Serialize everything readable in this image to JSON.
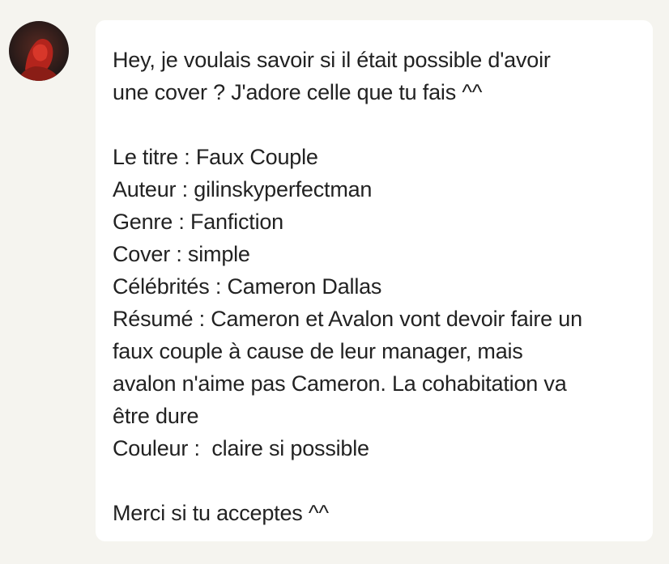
{
  "sender": {
    "avatar_icon": "user-avatar-photo"
  },
  "message": {
    "lines": [
      "Hey, je voulais savoir si il était possible d'avoir",
      "une cover ? J'adore celle que tu fais ^^",
      "",
      "Le titre : Faux Couple",
      "Auteur : gilinskyperfectman",
      "Genre : Fanfiction",
      "Cover : simple",
      "Célébrités : Cameron Dallas",
      "Résumé : Cameron et Avalon vont devoir faire un",
      "faux couple à cause de leur manager, mais",
      "avalon n'aime pas Cameron. La cohabitation va",
      "être dure",
      "Couleur :  claire si possible",
      "",
      "Merci si tu acceptes ^^"
    ]
  },
  "colors": {
    "background": "#f5f4ef",
    "bubble": "#ffffff",
    "text": "#222222"
  }
}
